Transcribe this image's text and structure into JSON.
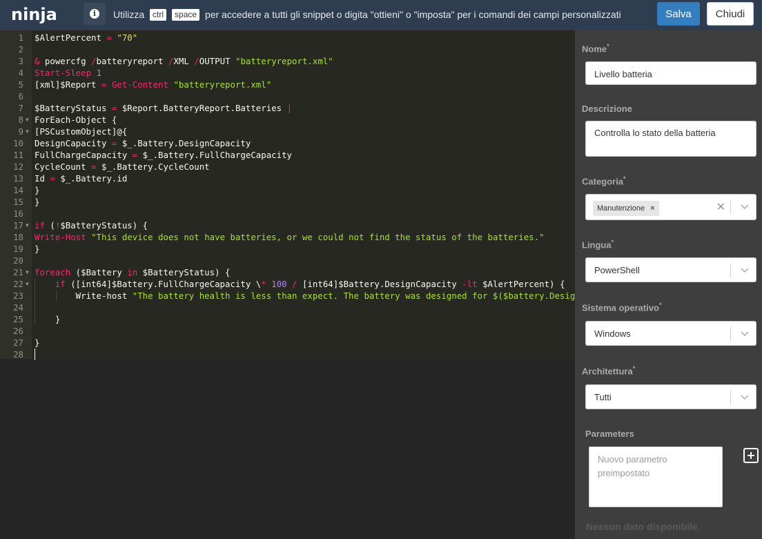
{
  "header": {
    "logo": "ninja",
    "hint_prefix": "Utilizza",
    "key1": "ctrl",
    "key2": "space",
    "hint_suffix": "per accedere a tutti gli snippet o digita \"ottieni\" o \"imposta\" per i comandi dei campi personalizzati",
    "save_label": "Salva",
    "close_label": "Chiudi"
  },
  "editor": {
    "line_numbers": [
      "1",
      "2",
      "3",
      "4",
      "5",
      "6",
      "7",
      "8",
      "9",
      "10",
      "11",
      "12",
      "13",
      "14",
      "15",
      "16",
      "17",
      "18",
      "19",
      "20",
      "21",
      "22",
      "23",
      "24",
      "25",
      "26",
      "27",
      "28"
    ]
  },
  "panel": {
    "name_label": "Nome",
    "name_value": "Livello batteria",
    "desc_label": "Descrizione",
    "desc_value": "Controlla lo stato della batteria",
    "category_label": "Categoria",
    "category_tag": "Manutenzione",
    "language_label": "Lingua",
    "language_value": "PowerShell",
    "os_label": "Sistema operativo",
    "os_value": "Windows",
    "arch_label": "Architettura",
    "arch_value": "Tutti",
    "params_label": "Parameters",
    "params_placeholder": "Nuovo parametro preimpostato",
    "no_data": "Nessun dato disponibile",
    "required_mark": "*"
  }
}
